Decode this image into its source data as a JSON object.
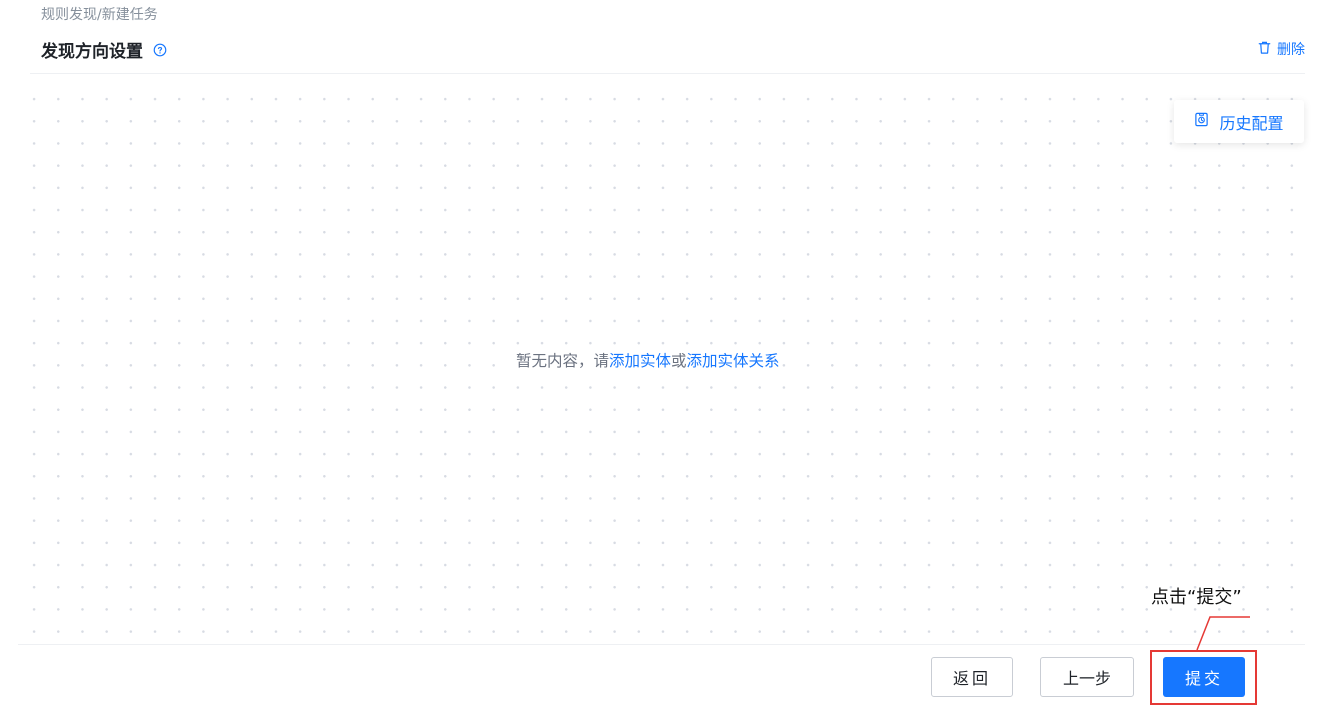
{
  "breadcrumb": "规则发现/新建任务",
  "header": {
    "title": "发现方向设置",
    "help_icon": "question-circle-icon",
    "delete_label": "删除",
    "delete_icon": "trash-icon"
  },
  "history": {
    "label": "历史配置",
    "icon": "history-doc-icon"
  },
  "empty": {
    "prefix": "暂无内容，请",
    "add_entity": "添加实体",
    "or": "或",
    "add_relation": "添加实体关系"
  },
  "footer": {
    "back_label": "返回",
    "prev_label": "上一步",
    "submit_label": "提交"
  },
  "annotation": {
    "text": "点击“提交”",
    "color": "#e53935"
  },
  "colors": {
    "accent": "#1677ff",
    "annotation_red": "#e53935"
  }
}
